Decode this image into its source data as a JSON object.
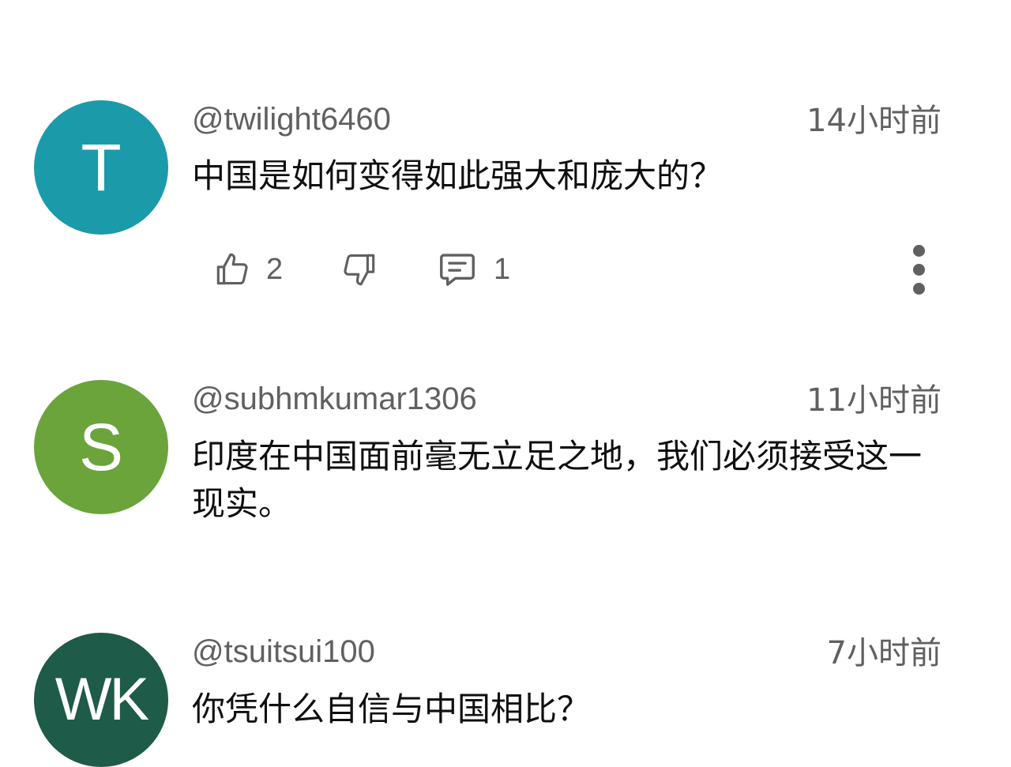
{
  "comments": [
    {
      "avatar_letter": "T",
      "avatar_color": "#1b9aaa",
      "handle": "@twilight6460",
      "time": "14小时前",
      "text": "中国是如何变得如此强大和庞大的？",
      "likes": "2",
      "replies": "1"
    },
    {
      "avatar_letter": "S",
      "avatar_color": "#6aa43a",
      "handle": "@subhmkumar1306",
      "time": "11小时前",
      "text": "印度在中国面前毫无立足之地，我们必须接受这一现实。"
    },
    {
      "avatar_letter": "WK",
      "avatar_color": "#1e5b48",
      "handle": "@tsuitsui100",
      "time": "7小时前",
      "text": "你凭什么自信与中国相比？"
    }
  ],
  "icons": {
    "like": "thumb-up-icon",
    "dislike": "thumb-down-icon",
    "reply": "comment-icon",
    "more": "more-vertical-icon"
  },
  "colors": {
    "secondary_text": "#606060",
    "primary_text": "#0f0f0f",
    "background": "#ffffff"
  }
}
